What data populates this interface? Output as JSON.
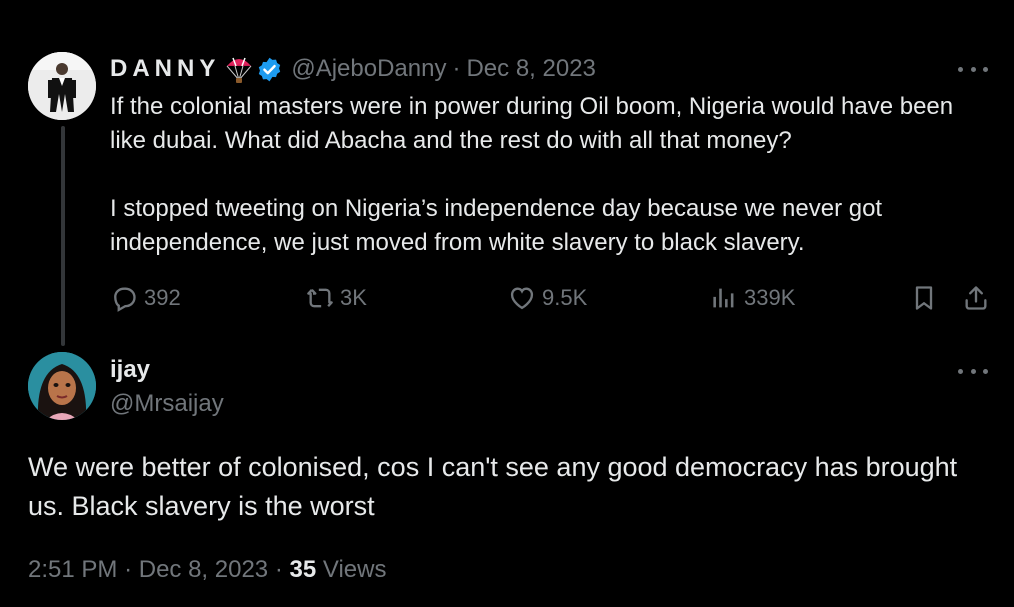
{
  "colors": {
    "background": "#000000",
    "text": "#e7e9ea",
    "muted": "#71767b",
    "verified": "#1d9bf0",
    "thread_line": "#333639"
  },
  "parent_tweet": {
    "display_name": "DANNY",
    "name_emoji_icon": "parachute-icon",
    "verified_icon": "verified-badge-icon",
    "handle": "@AjeboDanny",
    "separator": "·",
    "date": "Dec 8, 2023",
    "paragraphs": [
      "If the colonial masters were in power during Oil boom, Nigeria would have been like dubai. What did Abacha and the rest do with all that money?",
      "I stopped tweeting on Nigeria’s independence day because we never got independence, we just moved from white slavery to black slavery."
    ],
    "actions": {
      "replies": "392",
      "retweets": "3K",
      "likes": "9.5K",
      "views": "339K"
    }
  },
  "reply_tweet": {
    "display_name": "ijay",
    "handle": "@Mrsaijay",
    "text": "We were better of colonised, cos I can't see any good democracy has brought us. Black slavery is the worst",
    "time": "2:51 PM",
    "separator": "·",
    "date": "Dec 8, 2023",
    "views_count": "35",
    "views_label": "Views"
  }
}
